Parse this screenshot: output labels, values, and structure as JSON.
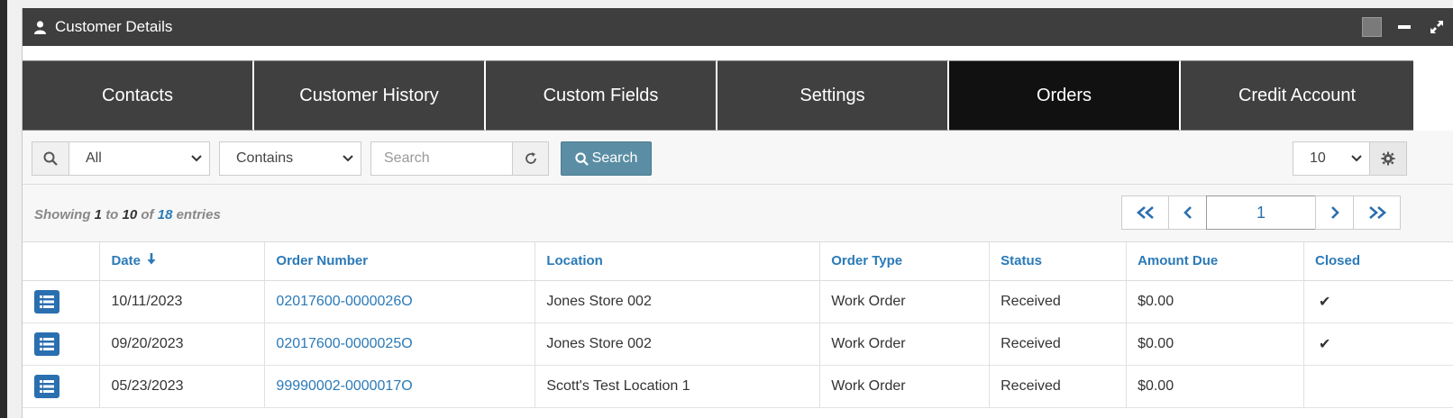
{
  "window": {
    "title": "Customer Details",
    "icons": [
      "user-icon",
      "color-square-icon",
      "minimize-icon",
      "expand-icon"
    ]
  },
  "tabs": [
    {
      "label": "Contacts",
      "active": false
    },
    {
      "label": "Customer History",
      "active": false
    },
    {
      "label": "Custom Fields",
      "active": false
    },
    {
      "label": "Settings",
      "active": false
    },
    {
      "label": "Orders",
      "active": true
    },
    {
      "label": "Credit Account",
      "active": false
    }
  ],
  "toolbar": {
    "field_select": "All",
    "operator_select": "Contains",
    "search_placeholder": "Search",
    "search_button": "Search",
    "page_size": "10"
  },
  "info": {
    "prefix": "Showing",
    "from": "1",
    "to_word": "to",
    "to": "10",
    "of_word": "of",
    "total": "18",
    "suffix": "entries"
  },
  "pager": {
    "current_page": "1"
  },
  "table": {
    "columns": [
      "",
      "Date",
      "Order Number",
      "Location",
      "Order Type",
      "Status",
      "Amount Due",
      "Closed"
    ],
    "rows": [
      {
        "date": "10/11/2023",
        "order_number": "02017600-0000026O",
        "location": "Jones Store 002",
        "order_type": "Work Order",
        "status": "Received",
        "amount_due": "$0.00",
        "closed": "✔"
      },
      {
        "date": "09/20/2023",
        "order_number": "02017600-0000025O",
        "location": "Jones Store 002",
        "order_type": "Work Order",
        "status": "Received",
        "amount_due": "$0.00",
        "closed": "✔"
      },
      {
        "date": "05/23/2023",
        "order_number": "99990002-0000017O",
        "location": "Scott's Test Location 1",
        "order_type": "Work Order",
        "status": "Received",
        "amount_due": "$0.00",
        "closed": ""
      }
    ]
  },
  "colors": {
    "titlebar": "#3e3e3e",
    "tab": "#404040",
    "tab_active": "#111111",
    "link": "#2a7ab8",
    "search_button": "#5b8ea4",
    "row_button": "#2a6fb0"
  }
}
